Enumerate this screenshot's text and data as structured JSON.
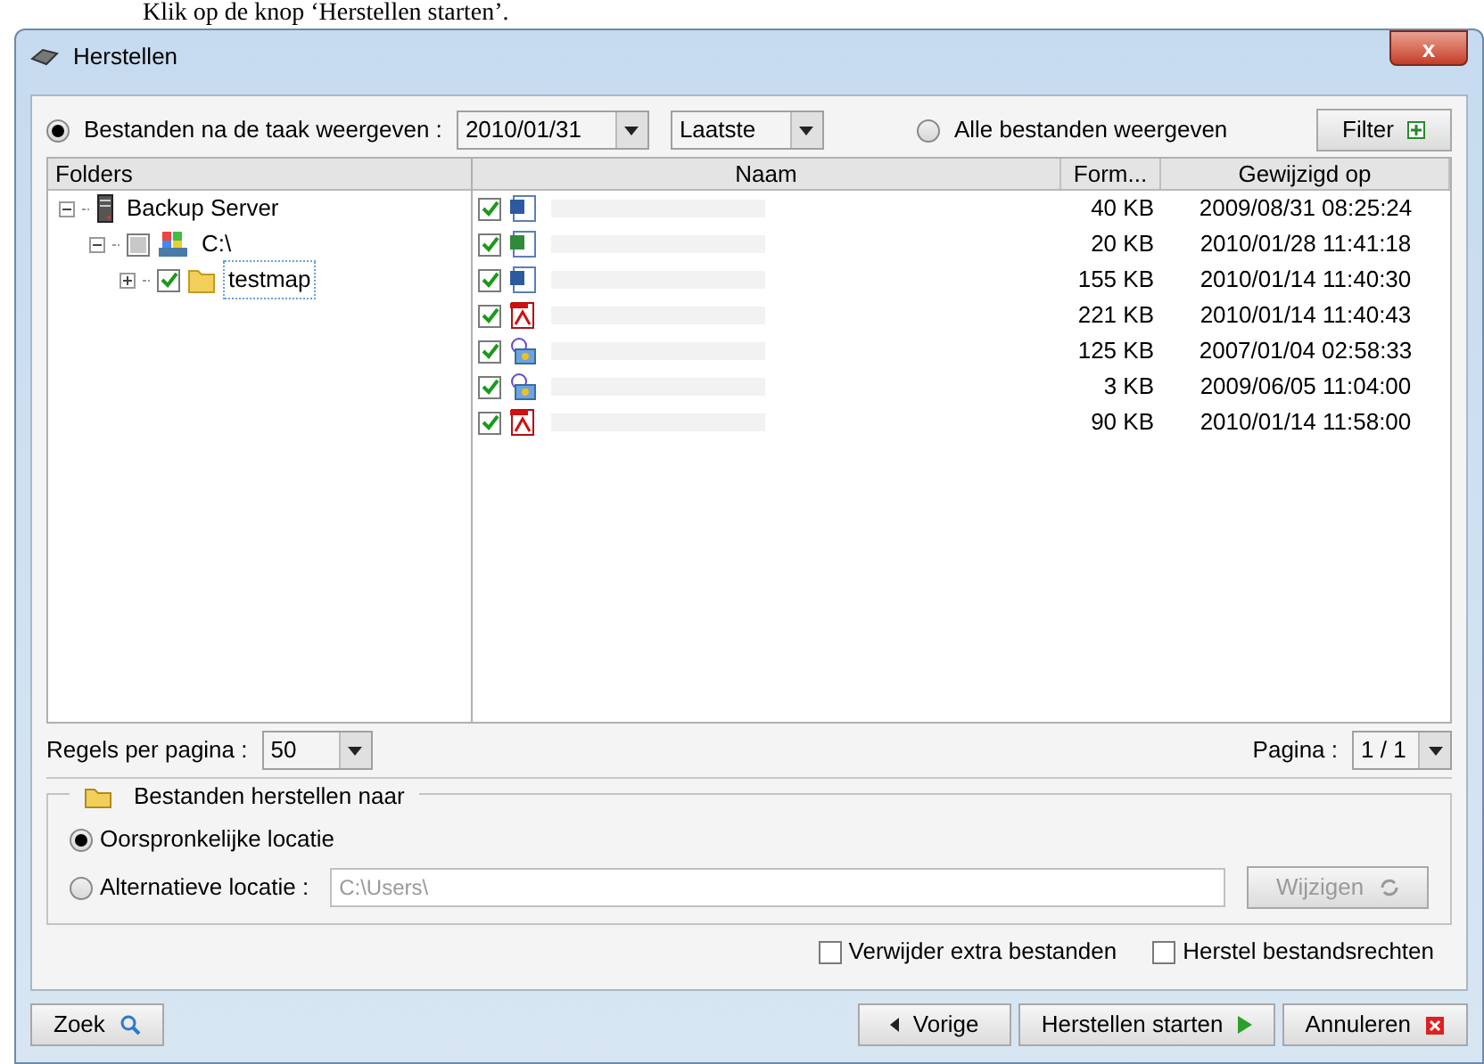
{
  "caption": "Klik op de knop ‘Herstellen starten’.",
  "window": {
    "title": "Herstellen",
    "close": "x"
  },
  "filter_bar": {
    "options": [
      {
        "label": "Bestanden na de taak weergeven :",
        "selected": true
      },
      {
        "label": "Alle bestanden weergeven",
        "selected": false
      }
    ],
    "date": "2010/01/31",
    "mode": "Laatste",
    "filter_button": "Filter"
  },
  "folders": {
    "header": "Folders",
    "tree": [
      {
        "label": "Backup Server",
        "kind": "server",
        "expanded": true,
        "children": [
          {
            "label": "C:\\",
            "kind": "drive",
            "expanded": true,
            "checked": false,
            "partial": true,
            "selected": false,
            "children": [
              {
                "label": "testmap",
                "kind": "folder",
                "expanded": false,
                "checked": true,
                "selected": true
              }
            ]
          }
        ],
        "selected": false
      }
    ]
  },
  "files": {
    "columns": [
      "Naam",
      "Form...",
      "Gewijzigd op"
    ],
    "rows": [
      {
        "kind": "word",
        "checked": true,
        "size": "40 KB",
        "modified": "2009/08/31 08:25:24"
      },
      {
        "kind": "excel",
        "checked": true,
        "size": "20 KB",
        "modified": "2010/01/28 11:41:18"
      },
      {
        "kind": "word",
        "checked": true,
        "size": "155 KB",
        "modified": "2010/01/14 11:40:30"
      },
      {
        "kind": "pdf",
        "checked": true,
        "size": "221 KB",
        "modified": "2010/01/14 11:40:43"
      },
      {
        "kind": "image",
        "checked": true,
        "size": "125 KB",
        "modified": "2007/01/04 02:58:33"
      },
      {
        "kind": "image",
        "checked": true,
        "size": "3 KB",
        "modified": "2009/06/05 11:04:00"
      },
      {
        "kind": "pdf",
        "checked": true,
        "size": "90 KB",
        "modified": "2010/01/14 11:58:00"
      }
    ]
  },
  "paging": {
    "rows_label": "Regels per pagina :",
    "rows_value": "50",
    "page_label": "Pagina :",
    "page_value": "1 / 1"
  },
  "restore_to": {
    "title": "Bestanden herstellen naar",
    "options": [
      {
        "label": "Oorspronkelijke locatie",
        "selected": true
      },
      {
        "label": "Alternatieve locatie :",
        "selected": false
      }
    ],
    "path": "C:\\Users\\",
    "change_button": "Wijzigen"
  },
  "checkboxes": [
    {
      "label": "Verwijder extra bestanden",
      "checked": false
    },
    {
      "label": "Herstel bestandsrechten",
      "checked": false
    }
  ],
  "buttons": {
    "search": "Zoek",
    "previous": "Vorige",
    "start": "Herstellen starten",
    "cancel": "Annuleren"
  }
}
